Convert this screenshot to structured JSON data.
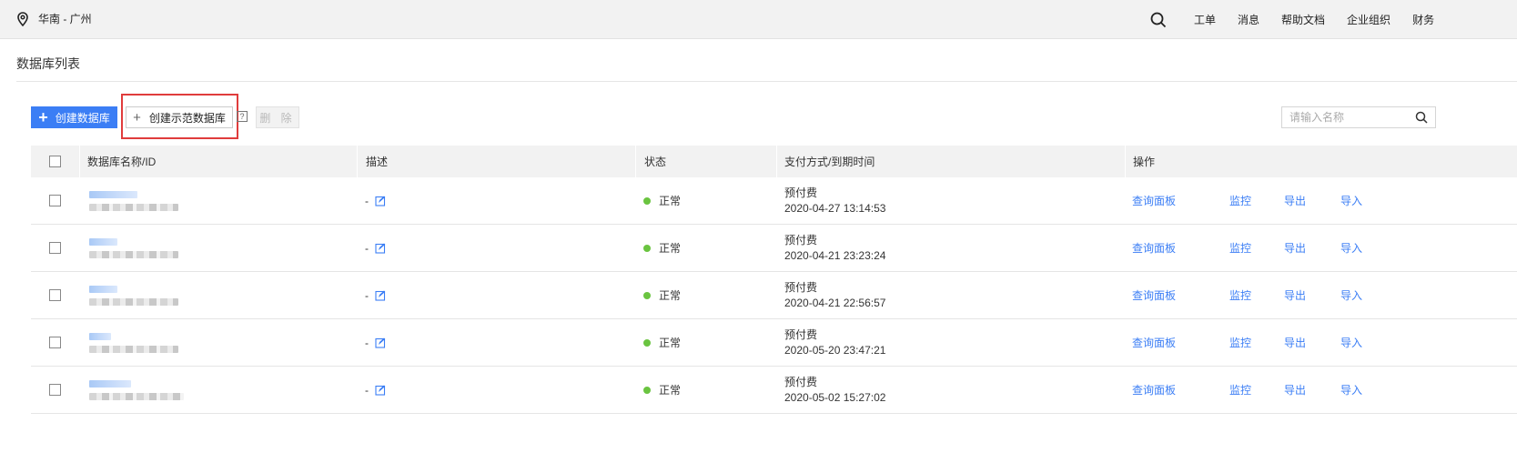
{
  "topbar": {
    "region": "华南 - 广州",
    "nav": [
      "工单",
      "消息",
      "帮助文档",
      "企业组织",
      "财务"
    ]
  },
  "page": {
    "title": "数据库列表"
  },
  "toolbar": {
    "create_label": "创建数据库",
    "create_demo_label": "创建示范数据库",
    "help_glyph": "?",
    "delete_label": "删 除",
    "search_placeholder": "请输入名称"
  },
  "table": {
    "headers": {
      "name": "数据库名称/ID",
      "desc": "描述",
      "status": "状态",
      "payment": "支付方式/到期时间",
      "actions": "操作"
    },
    "rows": [
      {
        "desc": "-",
        "status": "正常",
        "pay_type": "预付费",
        "expire": "2020-04-27 13:14:53"
      },
      {
        "desc": "-",
        "status": "正常",
        "pay_type": "预付费",
        "expire": "2020-04-21 23:23:24"
      },
      {
        "desc": "-",
        "status": "正常",
        "pay_type": "预付费",
        "expire": "2020-04-21 22:56:57"
      },
      {
        "desc": "-",
        "status": "正常",
        "pay_type": "预付费",
        "expire": "2020-05-20 23:47:21"
      },
      {
        "desc": "-",
        "status": "正常",
        "pay_type": "预付费",
        "expire": "2020-05-02 15:27:02"
      }
    ],
    "actions": {
      "query": "查询面板",
      "monitor": "监控",
      "export": "导出",
      "import": "导入"
    }
  },
  "colors": {
    "primary": "#3b7ef5",
    "status_ok": "#6ac440",
    "highlight": "#e03c3c"
  }
}
